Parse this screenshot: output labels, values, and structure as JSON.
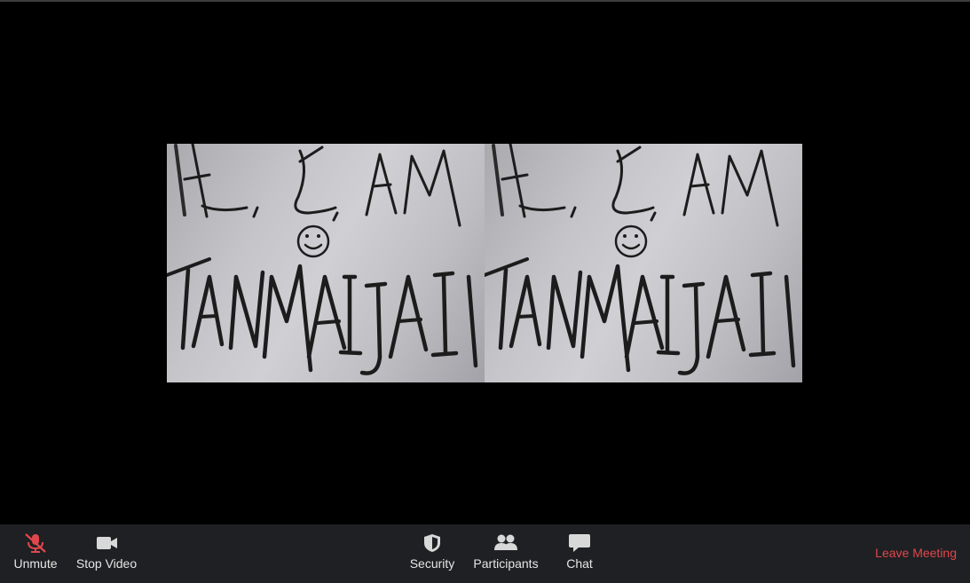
{
  "toolbar": {
    "unmute_label": "Unmute",
    "stop_video_label": "Stop Video",
    "security_label": "Security",
    "participants_label": "Participants",
    "chat_label": "Chat",
    "leave_label": "Leave Meeting"
  },
  "video": {
    "handwritten_text_line1": "HI, I, AM",
    "handwritten_text_line2": "TANMAIJAI"
  },
  "colors": {
    "toolbar_bg": "#1f2023",
    "muted_icon": "#e0474c",
    "leave_text": "#e0474c",
    "icon_gray": "#d8d8d8"
  },
  "icons": {
    "unmute": "microphone-muted-icon",
    "stop_video": "video-camera-icon",
    "security": "shield-icon",
    "participants": "participants-icon",
    "chat": "chat-bubble-icon"
  }
}
